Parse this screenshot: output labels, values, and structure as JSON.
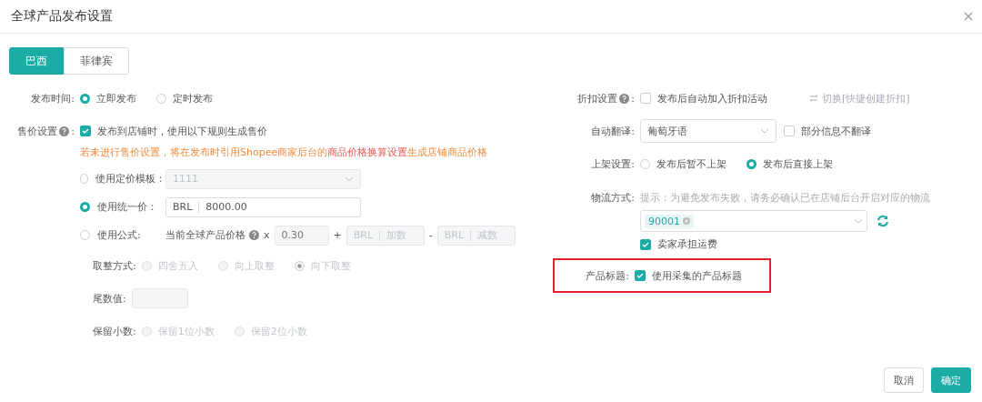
{
  "window": {
    "title": "全球产品发布设置"
  },
  "tabs": [
    {
      "label": "巴西",
      "selected": true
    },
    {
      "label": "菲律宾",
      "selected": false
    }
  ],
  "publish_time": {
    "label": "发布时间:",
    "options": [
      {
        "label": "立即发布",
        "selected": true
      },
      {
        "label": "定时发布",
        "selected": false
      }
    ]
  },
  "price_setting": {
    "label": "售价设置",
    "label_suffix": ":",
    "checkbox": {
      "label": "发布到店铺时，使用以下规则生成售价",
      "checked": true
    },
    "notice": {
      "before": "若未进行售价设置，将在发布时引用Shopee商家后台的",
      "link": "商品价格换算设置",
      "after": "生成店铺商品价格"
    },
    "methods": [
      {
        "kind": "template",
        "label": "使用定价模板：",
        "selected": false,
        "value": "1111"
      },
      {
        "kind": "fixed",
        "label": "使用统一价：",
        "selected": true,
        "currency": "BRL",
        "value": "8000.00"
      },
      {
        "kind": "formula",
        "label": "使用公式:",
        "selected": false,
        "base": "当前全球产品价格",
        "times": "x",
        "multiplier_placeholder": "0.30",
        "plus": "+",
        "plus_currency": "BRL",
        "plus_placeholder": "加数",
        "minus": "-",
        "minus_currency": "BRL",
        "minus_placeholder": "减数"
      }
    ],
    "rounding": {
      "label": "取整方式:",
      "options": [
        {
          "label": "四舍五入",
          "selected": false
        },
        {
          "label": "向上取整",
          "selected": false
        },
        {
          "label": "向下取整",
          "selected": true
        }
      ]
    },
    "tail": {
      "label": "尾数值:"
    },
    "decimals": {
      "label": "保留小数:",
      "options": [
        {
          "label": "保留1位小数",
          "selected": false
        },
        {
          "label": "保留2位小数",
          "selected": false
        }
      ]
    }
  },
  "discount": {
    "label": "折扣设置",
    "label_suffix": ":",
    "checkbox": {
      "label": "发布后自动加入折扣活动",
      "checked": false
    },
    "switch_link": "切换[快捷创建折扣]"
  },
  "translate": {
    "label": "自动翻译:",
    "value": "葡萄牙语",
    "checkbox": {
      "label": "部分信息不翻译",
      "checked": false
    }
  },
  "listing": {
    "label": "上架设置:",
    "options": [
      {
        "label": "发布后暂不上架",
        "selected": false
      },
      {
        "label": "发布后直接上架",
        "selected": true
      }
    ]
  },
  "logistics": {
    "label": "物流方式:",
    "hint": "提示：为避免发布失败，请务必确认已在店铺后台开启对应的物流",
    "tags": [
      "90001"
    ],
    "checkbox": {
      "label": "卖家承担运费",
      "checked": true
    }
  },
  "product_title": {
    "label": "产品标题:",
    "highlighted": true,
    "checkbox": {
      "label": "使用采集的产品标题",
      "checked": true
    }
  },
  "buttons": [
    {
      "label": "取消",
      "kind": "secondary"
    },
    {
      "label": "确定",
      "kind": "primary"
    }
  ]
}
